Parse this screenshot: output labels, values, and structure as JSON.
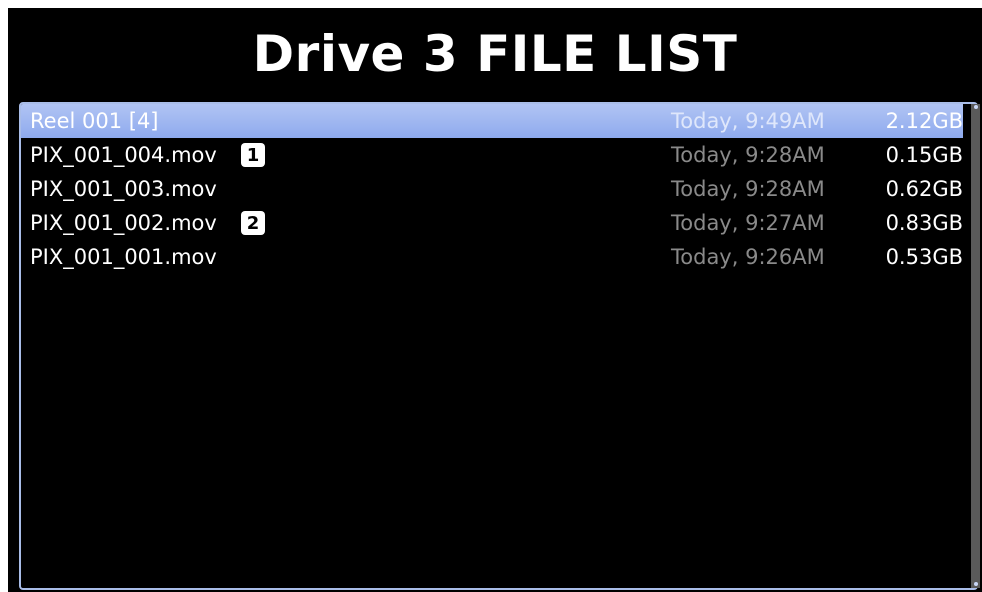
{
  "title": "Drive 3 FILE LIST",
  "rows": [
    {
      "name": "Reel 001 [4]",
      "badge": "",
      "date": "Today, 9:49AM",
      "size": "2.12GB",
      "selected": true
    },
    {
      "name": "PIX_001_004.mov",
      "badge": "1",
      "date": "Today, 9:28AM",
      "size": "0.15GB",
      "selected": false
    },
    {
      "name": "PIX_001_003.mov",
      "badge": "",
      "date": "Today, 9:28AM",
      "size": "0.62GB",
      "selected": false
    },
    {
      "name": "PIX_001_002.mov",
      "badge": "2",
      "date": "Today, 9:27AM",
      "size": "0.83GB",
      "selected": false
    },
    {
      "name": "PIX_001_001.mov",
      "badge": "",
      "date": "Today, 9:26AM",
      "size": "0.53GB",
      "selected": false
    }
  ],
  "colors": {
    "selection": "#9cb3f0",
    "panel_border": "#a9bde8",
    "date_text": "#8a8a8a"
  }
}
